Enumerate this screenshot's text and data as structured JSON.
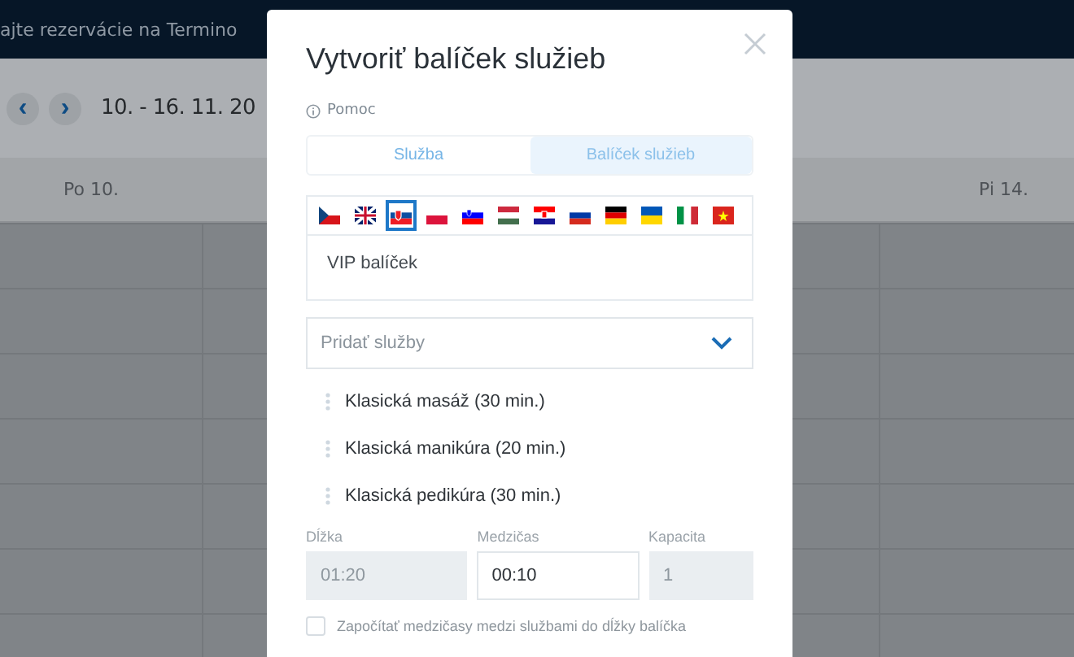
{
  "background": {
    "banner": "ajte rezervácie na Termino",
    "prev": "‹",
    "next": "›",
    "date_range": "10. - 16. 11. 20",
    "days": [
      "Po 10.",
      "Pi 14."
    ]
  },
  "dialog": {
    "title": "Vytvoriť balíček služieb",
    "help": "Pomoc",
    "tabs": [
      {
        "label": "Služba",
        "selected": false
      },
      {
        "label": "Balíček služieb",
        "selected": true
      }
    ],
    "languages": [
      {
        "kind": "cz",
        "selected": false
      },
      {
        "kind": "gb",
        "selected": false
      },
      {
        "kind": "sk",
        "selected": true
      },
      {
        "kind": "pl",
        "selected": false
      },
      {
        "kind": "si",
        "selected": false
      },
      {
        "kind": "hu",
        "selected": false
      },
      {
        "kind": "hr",
        "selected": false
      },
      {
        "kind": "ru",
        "selected": false
      },
      {
        "kind": "de",
        "selected": false
      },
      {
        "kind": "ua",
        "selected": false
      },
      {
        "kind": "it",
        "selected": false
      },
      {
        "kind": "vn",
        "selected": false
      }
    ],
    "name": "VIP balíček",
    "add_services": {
      "placeholder": "Pridať služby"
    },
    "services": [
      "Klasická masáž (30 min.)",
      "Klasická manikúra (20 min.)",
      "Klasická pedikúra (30 min.)"
    ],
    "fields": [
      {
        "label": "Dĺžka",
        "value": "01:20",
        "disabled": true
      },
      {
        "label": "Medzičas",
        "value": "00:10",
        "disabled": false
      },
      {
        "label": "Kapacita",
        "value": "1",
        "disabled": true
      }
    ],
    "include_breaks": {
      "label": "Započítať medzičasy medzi službami do dĺžky balíčka",
      "checked": false
    }
  }
}
